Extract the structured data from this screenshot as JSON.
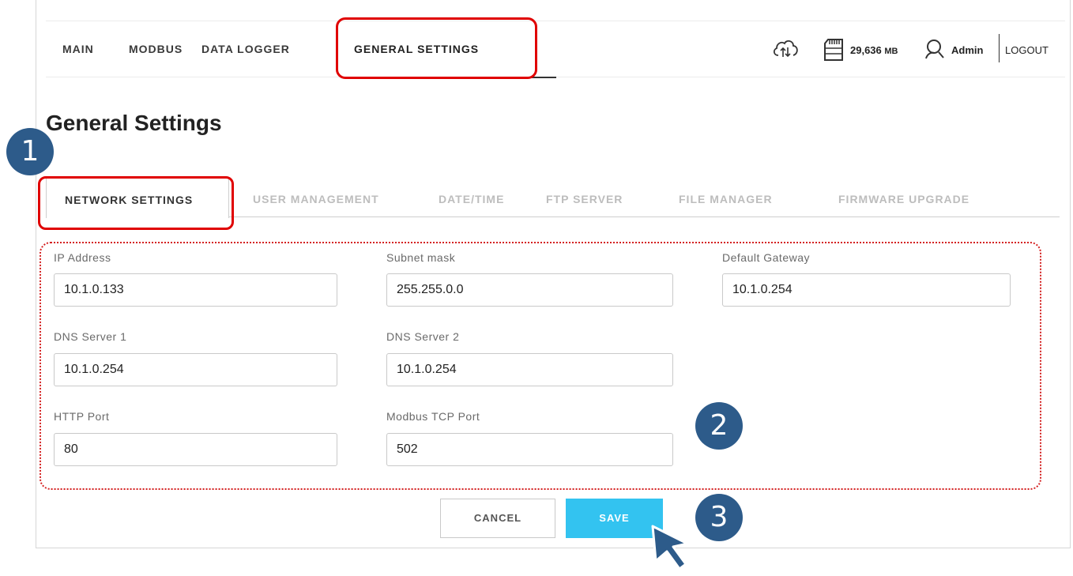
{
  "nav": {
    "items": [
      "MAIN",
      "MODBUS",
      "DATA LOGGER",
      "GENERAL SETTINGS"
    ],
    "active": "GENERAL SETTINGS"
  },
  "header_tools": {
    "cloud_icon": "cloud-sync-icon",
    "storage_icon": "sd-card-icon",
    "storage_value": "29,636",
    "storage_unit": "MB",
    "user_icon": "user-icon",
    "username": "Admin",
    "logout": "LOGOUT"
  },
  "page": {
    "title": "General Settings"
  },
  "badges": [
    "1",
    "2",
    "3"
  ],
  "tabs": {
    "items": [
      "NETWORK SETTINGS",
      "USER MANAGEMENT",
      "DATE/TIME",
      "FTP SERVER",
      "FILE MANAGER",
      "FIRMWARE UPGRADE"
    ],
    "active": "NETWORK SETTINGS"
  },
  "form": {
    "ip_address": {
      "label": "IP Address",
      "value": "10.1.0.133"
    },
    "subnet_mask": {
      "label": "Subnet mask",
      "value": "255.255.0.0"
    },
    "default_gateway": {
      "label": "Default Gateway",
      "value": "10.1.0.254"
    },
    "dns_server_1": {
      "label": "DNS Server 1",
      "value": "10.1.0.254"
    },
    "dns_server_2": {
      "label": "DNS Server 2",
      "value": "10.1.0.254"
    },
    "http_port": {
      "label": "HTTP Port",
      "value": "80"
    },
    "modbus_tcp_port": {
      "label": "Modbus TCP Port",
      "value": "502"
    }
  },
  "buttons": {
    "cancel": "CANCEL",
    "save": "SAVE"
  },
  "colors": {
    "highlight": "#e00000",
    "badge": "#2d5b8a",
    "save": "#33c3f0"
  }
}
